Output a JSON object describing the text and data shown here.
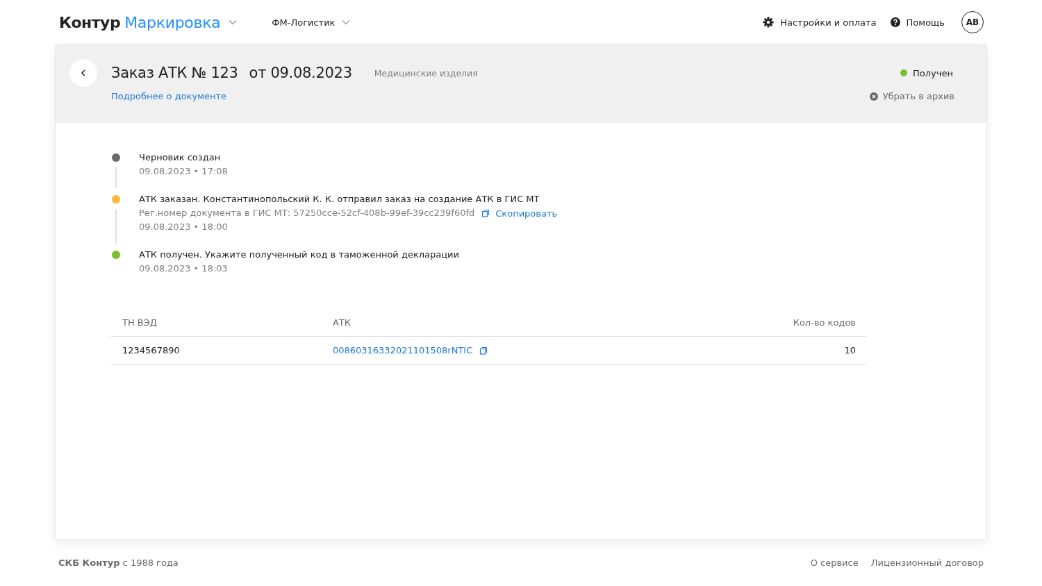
{
  "topbar": {
    "logo_brand": "Контур",
    "logo_product": "Маркировка",
    "organization": "ФМ-Логистик",
    "settings": "Настройки и оплата",
    "help": "Помощь",
    "avatar": "АВ"
  },
  "document": {
    "title": "Заказ АТК № 123",
    "date": "от 09.08.2023",
    "category": "Медицинские изделия",
    "details_link": "Подробнее о документе",
    "status": {
      "label": "Получен",
      "color": "#78bf2b"
    },
    "archive": "Убрать в архив"
  },
  "timeline": [
    {
      "text": "Черновик создан",
      "time": "09.08.2023 • 17:08",
      "color": "#6b6b6b"
    },
    {
      "text": "АТК заказан. Константинопольский К. К. отправил заказ на создание АТК в ГИС МТ",
      "reg_number": "Рег.номер документа в ГИС МТ: 57250cce-52cf-408b-99ef-39cc239f60fd",
      "copy": "Скопировать",
      "time": "09.08.2023 • 18:00",
      "color": "#fcb73e"
    },
    {
      "text": "АТК получен. Укажите полученный код в таможенной декларации",
      "time": "09.08.2023 • 18:03",
      "color": "#78bf2b"
    }
  ],
  "table": {
    "columns": [
      "ТН ВЭД",
      "АТК",
      "Кол-во кодов"
    ],
    "rows": [
      {
        "tnved": "1234567890",
        "atk": "00860316332021101508rNTIC",
        "count": "10"
      }
    ]
  },
  "footer": {
    "copyright": "**СКБ Контур** с 1988 года",
    "links": [
      "О сервисе",
      "Лицензионный договор"
    ]
  }
}
